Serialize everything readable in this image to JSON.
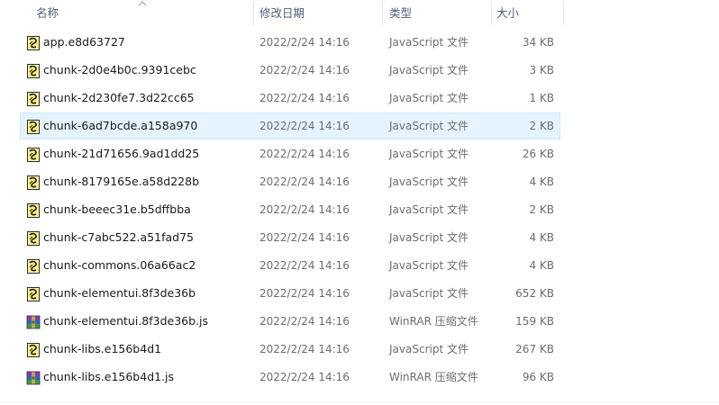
{
  "columns": {
    "name": "名称",
    "date": "修改日期",
    "type": "类型",
    "size": "大小"
  },
  "icons": {
    "js": "javascript-file-icon",
    "rar": "winrar-archive-icon",
    "sort": "sort-ascending-chevron-icon"
  },
  "files": [
    {
      "name": "app.e8d63727",
      "date": "2022/2/24 14:16",
      "type": "JavaScript 文件",
      "size": "34 KB",
      "icon": "js",
      "selected": false
    },
    {
      "name": "chunk-2d0e4b0c.9391cebc",
      "date": "2022/2/24 14:16",
      "type": "JavaScript 文件",
      "size": "3 KB",
      "icon": "js",
      "selected": false
    },
    {
      "name": "chunk-2d230fe7.3d22cc65",
      "date": "2022/2/24 14:16",
      "type": "JavaScript 文件",
      "size": "1 KB",
      "icon": "js",
      "selected": false
    },
    {
      "name": "chunk-6ad7bcde.a158a970",
      "date": "2022/2/24 14:16",
      "type": "JavaScript 文件",
      "size": "2 KB",
      "icon": "js",
      "selected": true
    },
    {
      "name": "chunk-21d71656.9ad1dd25",
      "date": "2022/2/24 14:16",
      "type": "JavaScript 文件",
      "size": "26 KB",
      "icon": "js",
      "selected": false
    },
    {
      "name": "chunk-8179165e.a58d228b",
      "date": "2022/2/24 14:16",
      "type": "JavaScript 文件",
      "size": "4 KB",
      "icon": "js",
      "selected": false
    },
    {
      "name": "chunk-beeec31e.b5dffbba",
      "date": "2022/2/24 14:16",
      "type": "JavaScript 文件",
      "size": "2 KB",
      "icon": "js",
      "selected": false
    },
    {
      "name": "chunk-c7abc522.a51fad75",
      "date": "2022/2/24 14:16",
      "type": "JavaScript 文件",
      "size": "4 KB",
      "icon": "js",
      "selected": false
    },
    {
      "name": "chunk-commons.06a66ac2",
      "date": "2022/2/24 14:16",
      "type": "JavaScript 文件",
      "size": "4 KB",
      "icon": "js",
      "selected": false
    },
    {
      "name": "chunk-elementui.8f3de36b",
      "date": "2022/2/24 14:16",
      "type": "JavaScript 文件",
      "size": "652 KB",
      "icon": "js",
      "selected": false
    },
    {
      "name": "chunk-elementui.8f3de36b.js",
      "date": "2022/2/24 14:16",
      "type": "WinRAR 压缩文件",
      "size": "159 KB",
      "icon": "rar",
      "selected": false
    },
    {
      "name": "chunk-libs.e156b4d1",
      "date": "2022/2/24 14:16",
      "type": "JavaScript 文件",
      "size": "267 KB",
      "icon": "js",
      "selected": false
    },
    {
      "name": "chunk-libs.e156b4d1.js",
      "date": "2022/2/24 14:16",
      "type": "WinRAR 压缩文件",
      "size": "96 KB",
      "icon": "rar",
      "selected": false
    }
  ]
}
